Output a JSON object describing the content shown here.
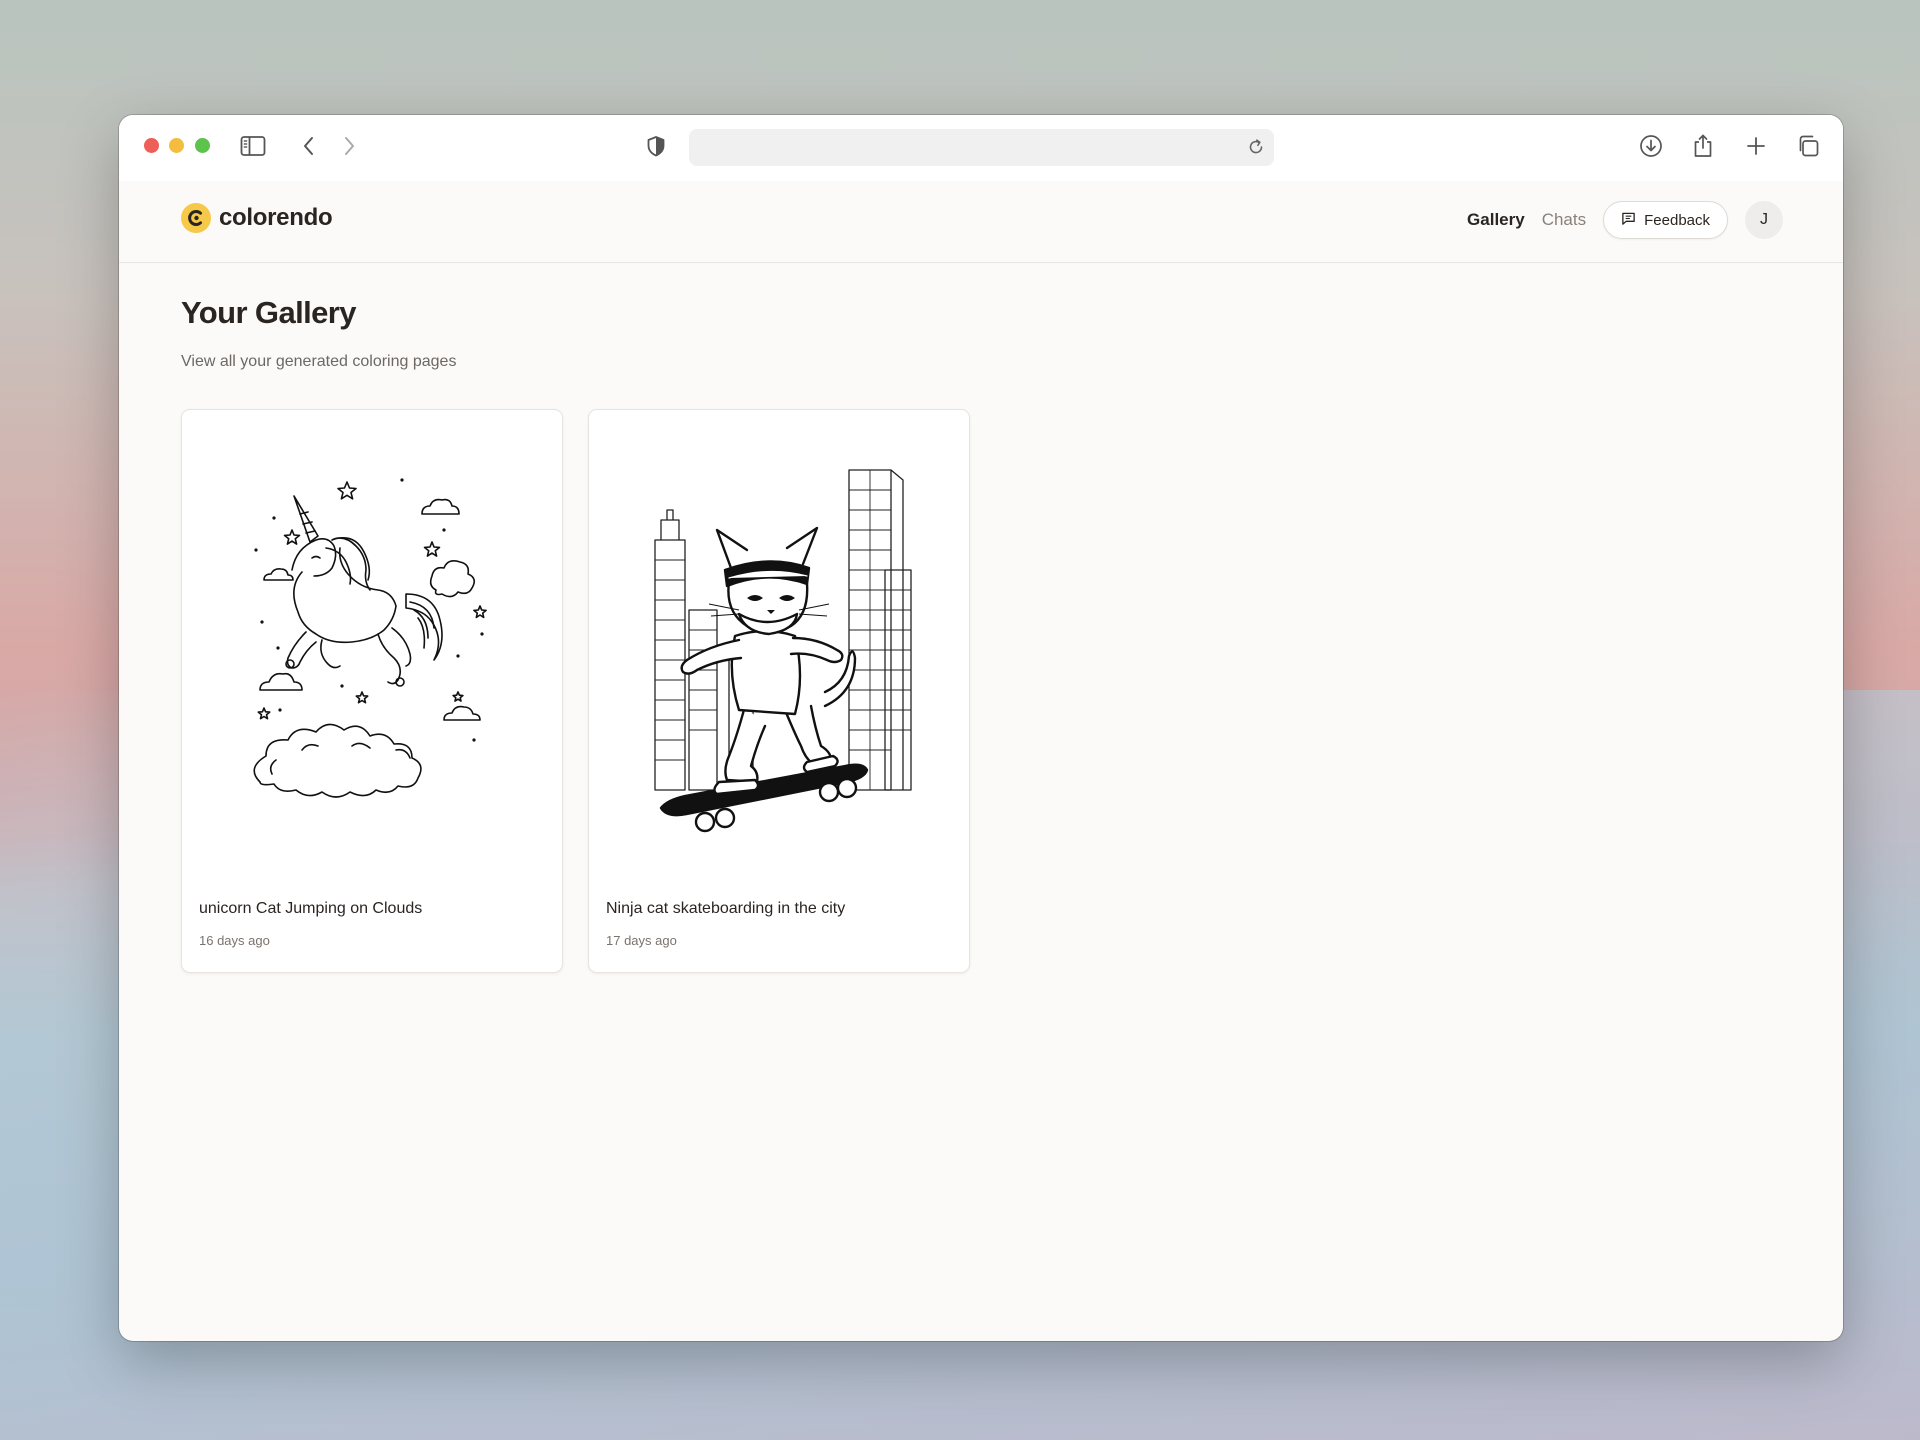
{
  "app": {
    "name": "colorendo"
  },
  "nav": {
    "gallery": "Gallery",
    "chats": "Chats",
    "feedback": "Feedback",
    "avatar_initial": "J"
  },
  "page": {
    "title": "Your Gallery",
    "subtitle": "View all your generated coloring pages"
  },
  "gallery": {
    "items": [
      {
        "title": "unicorn Cat Jumping on Clouds",
        "date": "16 days ago"
      },
      {
        "title": "Ninja cat skateboarding in the city",
        "date": "17 days ago"
      }
    ]
  },
  "browser": {
    "address_text": ""
  },
  "colors": {
    "brand_yellow": "#f7c948",
    "text_primary": "#2b2522",
    "text_muted": "#8a817b"
  }
}
